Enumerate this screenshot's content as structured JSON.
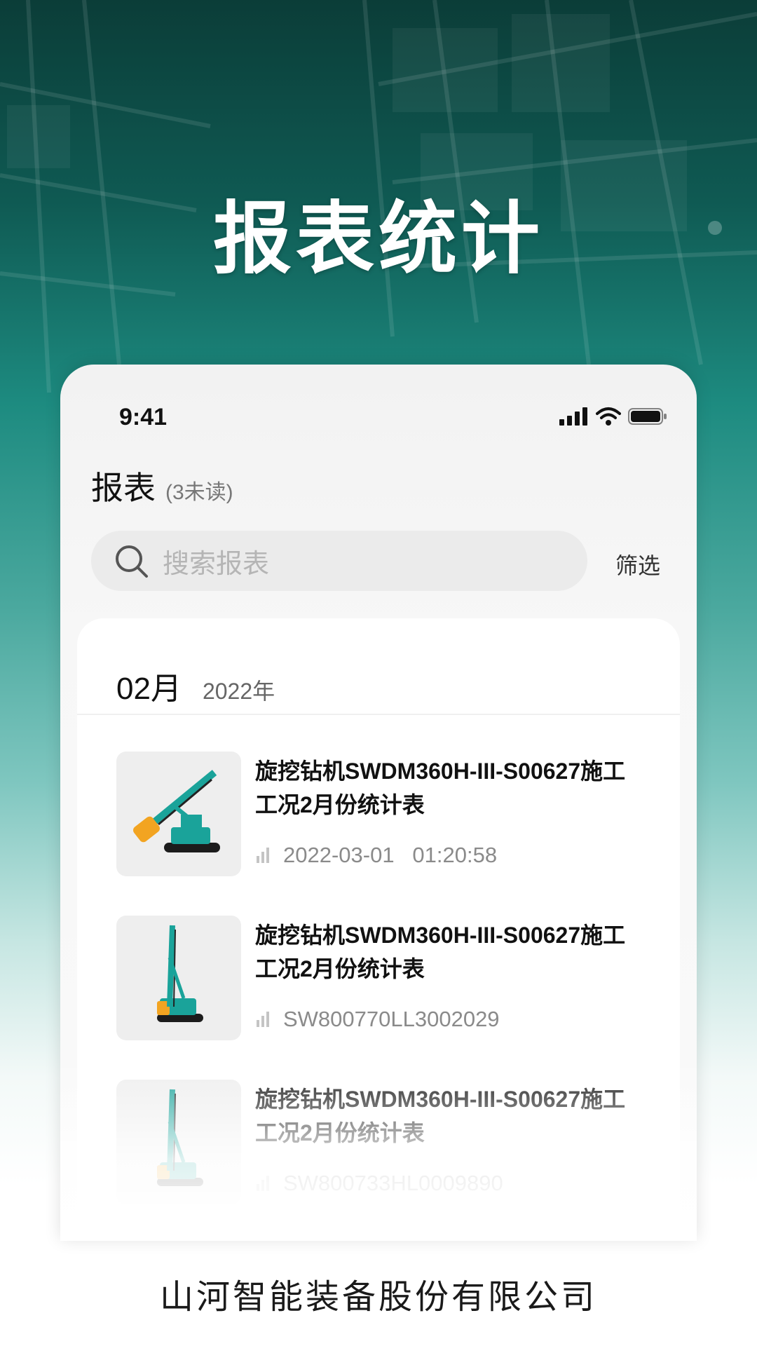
{
  "hero": {
    "title": "报表统计"
  },
  "status_bar": {
    "time": "9:41"
  },
  "header": {
    "title": "报表",
    "unread": "(3未读)"
  },
  "search": {
    "placeholder": "搜索报表"
  },
  "filter": {
    "label": "筛选"
  },
  "list": {
    "month": "02月",
    "year": "2022年",
    "items": [
      {
        "title": "旋挖钻机SWDM360H-III-S00627施工工况2月份统计表",
        "meta": "2022-03-01   01:20:58",
        "thumb_icon": "rotary-drilling-rig-icon"
      },
      {
        "title": "旋挖钻机SWDM360H-III-S00627施工工况2月份统计表",
        "meta": "SW800770LL3002029",
        "thumb_icon": "rotary-drilling-rig-icon"
      },
      {
        "title": "旋挖钻机SWDM360H-III-S00627施工工况2月份统计表",
        "meta": "SW800733HL0009890",
        "thumb_icon": "rotary-drilling-rig-icon"
      }
    ]
  },
  "footer": {
    "company": "山河智能装备股份有限公司"
  },
  "colors": {
    "accent": "#1d8b80",
    "rig_teal": "#1aa39a",
    "rig_orange": "#f2a421"
  }
}
